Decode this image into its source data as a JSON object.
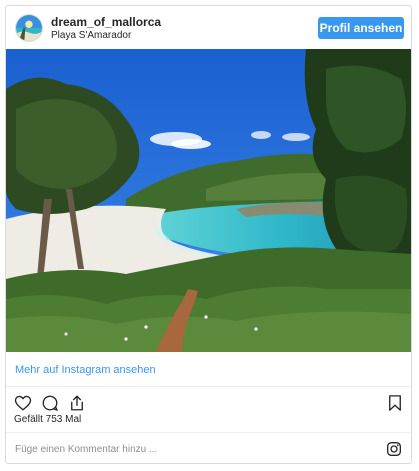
{
  "post": {
    "username": "dream_of_mallorca",
    "location": "Playa S'Amarador",
    "profile_button": "Profil ansehen",
    "photo_alt": "Beach cove with turquoise water and pine trees",
    "more_link": "Mehr auf Instagram ansehen",
    "likes": "Gefällt 753 Mal",
    "comment_placeholder": "Füge einen Kommentar hinzu ...",
    "accent_color": "#3897f0"
  },
  "icons": {
    "like": "heart-icon",
    "comment": "comment-icon",
    "share": "share-icon",
    "save": "bookmark-icon",
    "brand": "instagram-icon"
  }
}
